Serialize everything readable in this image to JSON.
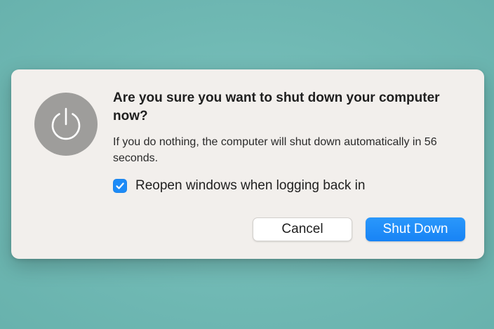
{
  "colors": {
    "background": "#72bbb6",
    "dialog": "#f2efec",
    "accent": "#1d8bf7",
    "icon_circle": "#9e9d9b"
  },
  "dialog": {
    "icon": "power-icon",
    "title": "Are you sure you want to shut down your computer now?",
    "message": "If you do nothing, the computer will shut down automatically in 56 seconds.",
    "checkbox": {
      "label": "Reopen windows when logging back in",
      "checked": true
    },
    "buttons": {
      "cancel": "Cancel",
      "confirm": "Shut Down"
    }
  }
}
